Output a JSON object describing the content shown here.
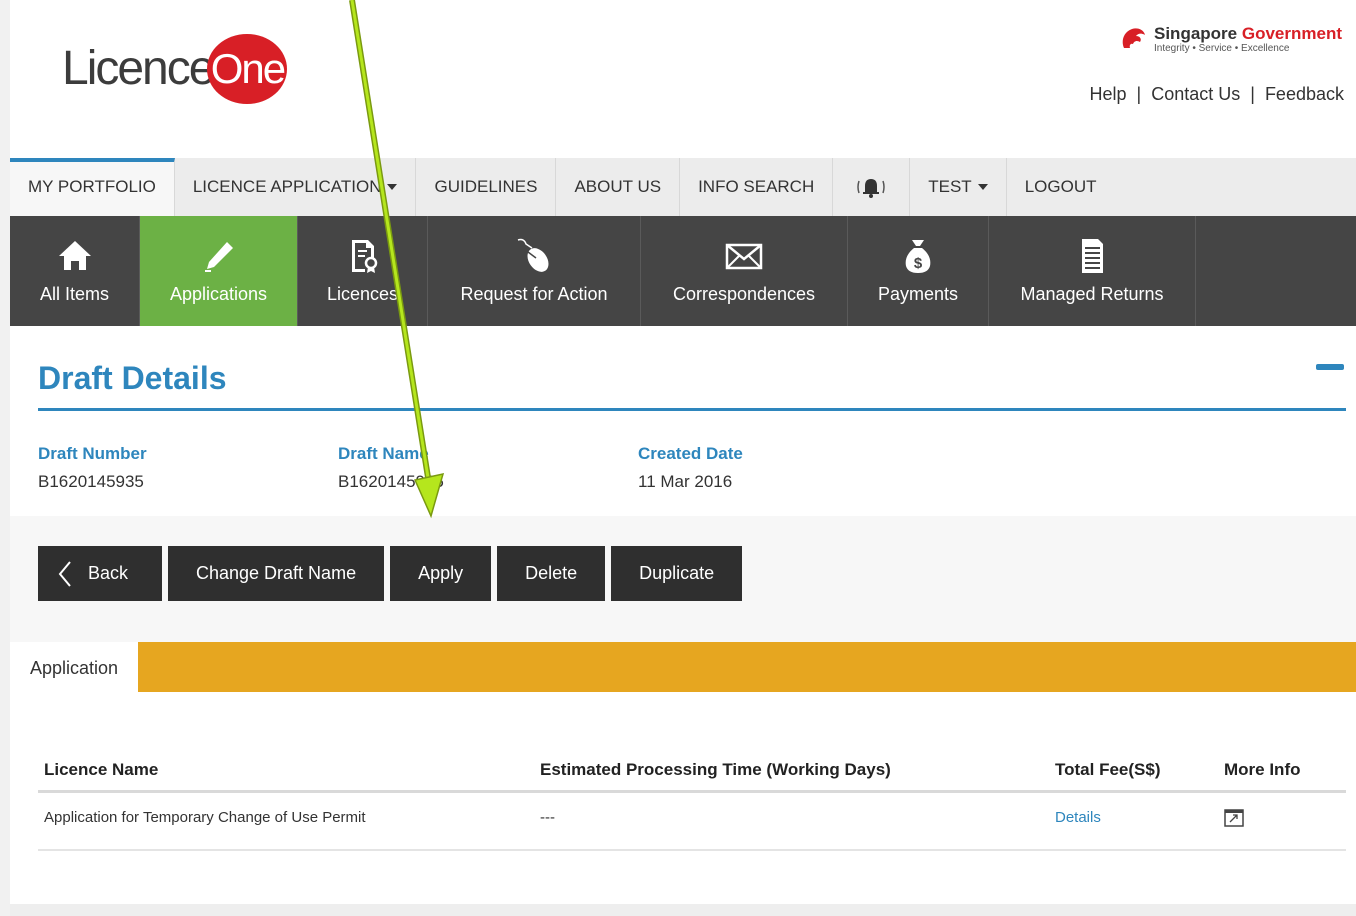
{
  "header": {
    "logo_text_1": "Licence",
    "logo_text_2": "One",
    "gov_title_1": "Singapore",
    "gov_title_2": "Government",
    "gov_motto": "Integrity • Service • Excellence",
    "links": [
      "Help",
      "Contact Us",
      "Feedback"
    ]
  },
  "topnav": {
    "items": [
      {
        "label": "MY PORTFOLIO",
        "active": true
      },
      {
        "label": "LICENCE APPLICATION",
        "dropdown": true
      },
      {
        "label": "GUIDELINES"
      },
      {
        "label": "ABOUT US"
      },
      {
        "label": "INFO SEARCH"
      },
      {
        "label": "",
        "icon": "bell-icon"
      },
      {
        "label": "TEST",
        "dropdown": true
      },
      {
        "label": "LOGOUT"
      }
    ]
  },
  "iconnav": {
    "tiles": [
      {
        "label": "All Items",
        "icon": "home-icon"
      },
      {
        "label": "Applications",
        "icon": "pencil-icon",
        "active": true
      },
      {
        "label": "Licences",
        "icon": "certificate-icon"
      },
      {
        "label": "Request for Action",
        "icon": "mouse-icon"
      },
      {
        "label": "Correspondences",
        "icon": "envelope-icon"
      },
      {
        "label": "Payments",
        "icon": "money-bag-icon"
      },
      {
        "label": "Managed Returns",
        "icon": "document-icon"
      }
    ]
  },
  "draft": {
    "title": "Draft Details",
    "number_label": "Draft Number",
    "number_value": "B1620145935",
    "name_label": "Draft Name",
    "name_value": "B1620145935",
    "date_label": "Created Date",
    "date_value": "11 Mar 2016"
  },
  "actions": {
    "back": "Back",
    "change_name": "Change Draft Name",
    "apply": "Apply",
    "delete": "Delete",
    "duplicate": "Duplicate"
  },
  "tabs": {
    "application": "Application"
  },
  "table": {
    "headers": [
      "Licence Name",
      "Estimated Processing Time (Working Days)",
      "Total Fee(S$)",
      "More Info"
    ],
    "rows": [
      {
        "licence_name": "Application for Temporary Change of Use Permit",
        "processing_time": "---",
        "fee": "Details",
        "more_info_icon": "popup-icon"
      }
    ]
  },
  "colors": {
    "accent_blue": "#2e86bd",
    "active_green": "#6cb145",
    "tab_orange": "#e6a620",
    "brand_red": "#d81f26",
    "annotation_green": "#9acd32"
  }
}
